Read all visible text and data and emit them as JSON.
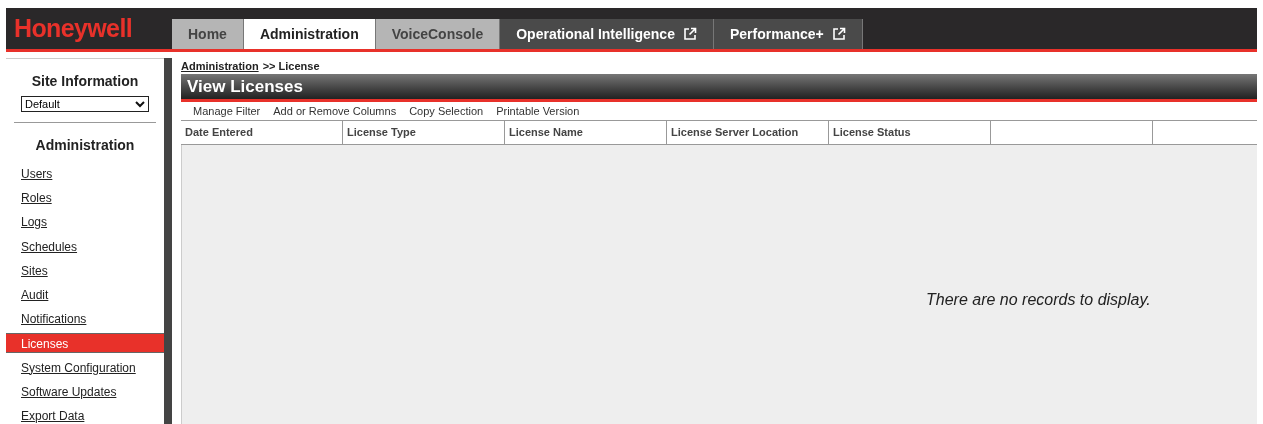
{
  "header": {
    "logo": "Honeywell",
    "tabs": [
      {
        "label": "Home",
        "kind": "internal",
        "selected": false
      },
      {
        "label": "Administration",
        "kind": "internal",
        "selected": true
      },
      {
        "label": "VoiceConsole",
        "kind": "internal",
        "selected": false
      },
      {
        "label": "Operational Intelligence",
        "kind": "external",
        "selected": false
      },
      {
        "label": "Performance+",
        "kind": "external",
        "selected": false
      }
    ]
  },
  "sidebar": {
    "site_title": "Site Information",
    "site_select": "Default",
    "section_title": "Administration",
    "items": [
      {
        "label": "Users",
        "selected": false
      },
      {
        "label": "Roles",
        "selected": false
      },
      {
        "label": "Logs",
        "selected": false
      },
      {
        "label": "Schedules",
        "selected": false
      },
      {
        "label": "Sites",
        "selected": false
      },
      {
        "label": "Audit",
        "selected": false
      },
      {
        "label": "Notifications",
        "selected": false
      },
      {
        "label": "Licenses",
        "selected": true
      },
      {
        "label": "System Configuration",
        "selected": false
      },
      {
        "label": "Software Updates",
        "selected": false
      },
      {
        "label": "Export Data",
        "selected": false
      }
    ]
  },
  "breadcrumb": {
    "link": "Administration",
    "current": ">> License"
  },
  "panel": {
    "title": "View Licenses",
    "toolbar": [
      "Manage Filter",
      "Add or Remove Columns",
      "Copy Selection",
      "Printable Version"
    ],
    "table": {
      "columns": [
        "Date Entered",
        "License Type",
        "License Name",
        "License Server Location",
        "License Status"
      ],
      "empty_message": "There are no records to display."
    }
  }
}
